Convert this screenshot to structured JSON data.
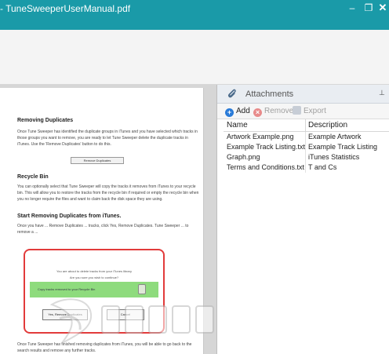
{
  "window": {
    "title": "- TuneSweeperUserManual.pdf",
    "minimize_glyph": "–",
    "maximize_glyph": "❐",
    "close_glyph": "✕"
  },
  "document": {
    "heading_removing": "Removing Duplicates",
    "para1": "Once Tune Sweeper has identified the duplicate groups in iTunes and you have selected which tracks in those groups you want to remove, you are ready to let Tune Sweeper delete the duplicate tracks in iTunes. Use the 'Remove Duplicates' button to do this.",
    "remove_button": "Remove Duplicates",
    "heading_recycle": "Recycle Bin",
    "para2": "You can optionally select that Tune Sweeper will copy the tracks it removes from iTunes to your recycle bin. This will allow you to restore the tracks from the recycle bin if required or empty the recycle bin when you no longer require the files and want to claim back the disk space they are using.",
    "heading_start": "Start Removing Duplicates from iTunes.",
    "para3": "Once you have ... Remove Duplicates ... tracks, click Yes, Remove Duplicates. Tune Sweeper ... to remove a ...",
    "dialog_line1": "You are about to delete tracks from your iTunes library",
    "dialog_line2": "Are you sure you wish to continue?",
    "dialog_checkbox": "Copy tracks removed to your Recycle Bin",
    "dialog_yes": "Yes, Remove Duplicates",
    "dialog_cancel": "Cancel",
    "para4": "Once Tune Sweeper has finished removing duplicates from iTunes, you will be able to go back to the search results and remove any further tracks."
  },
  "attachments": {
    "title": "Attachments",
    "pin_glyph": "⊥",
    "toolbar": {
      "add": "Add",
      "remove": "Remove",
      "export": "Export"
    },
    "columns": [
      "Name",
      "Description"
    ],
    "rows": [
      {
        "name": "Artwork Example.png",
        "description": "Example Artwork"
      },
      {
        "name": "Example Track Listing.txt",
        "description": "Example Track Listing"
      },
      {
        "name": "Graph.png",
        "description": "iTunes Statistics"
      },
      {
        "name": "Terms and Conditions.txt",
        "description": "T and Cs"
      }
    ]
  },
  "colors": {
    "titlebar": "#1a9aa8",
    "dialog_border": "#e23b3b",
    "dialog_highlight": "#8edb7d"
  }
}
